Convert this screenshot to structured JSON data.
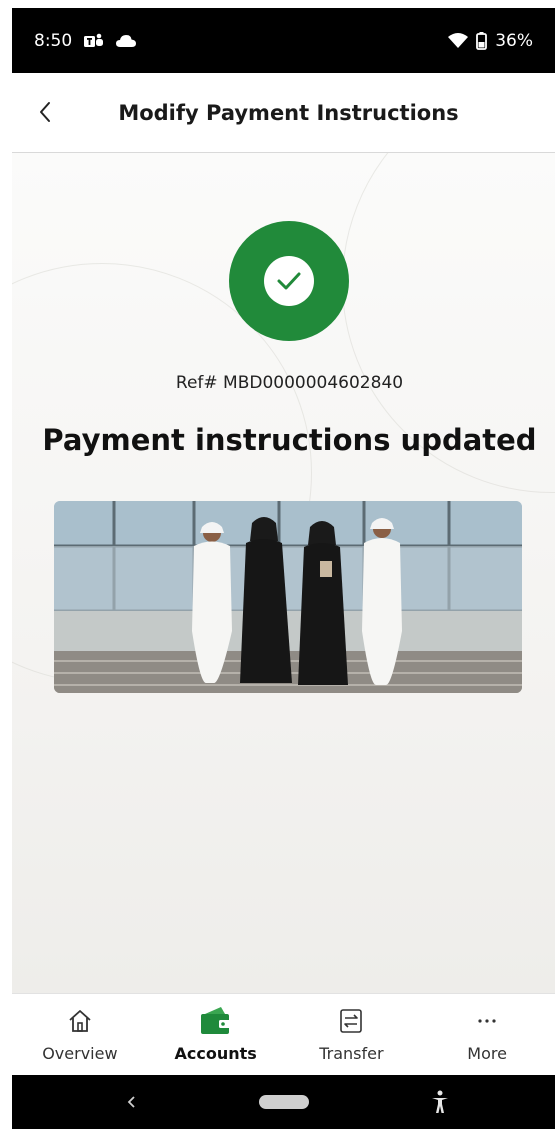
{
  "status_bar": {
    "time": "8:50",
    "battery": "36%"
  },
  "header": {
    "title": "Modify Payment Instructions"
  },
  "confirmation": {
    "reference": "Ref# MBD0000004602840",
    "title": "Payment instructions updated"
  },
  "bottom_nav": {
    "items": [
      {
        "label": "Overview",
        "icon": "home-icon",
        "active": false
      },
      {
        "label": "Accounts",
        "icon": "wallet-icon",
        "active": true
      },
      {
        "label": "Transfer",
        "icon": "transfer-icon",
        "active": false
      },
      {
        "label": "More",
        "icon": "more-icon",
        "active": false
      }
    ]
  },
  "colors": {
    "success_green": "#218a3a",
    "accent_green": "#1f8a3b",
    "status_bar_bg": "#000000"
  }
}
